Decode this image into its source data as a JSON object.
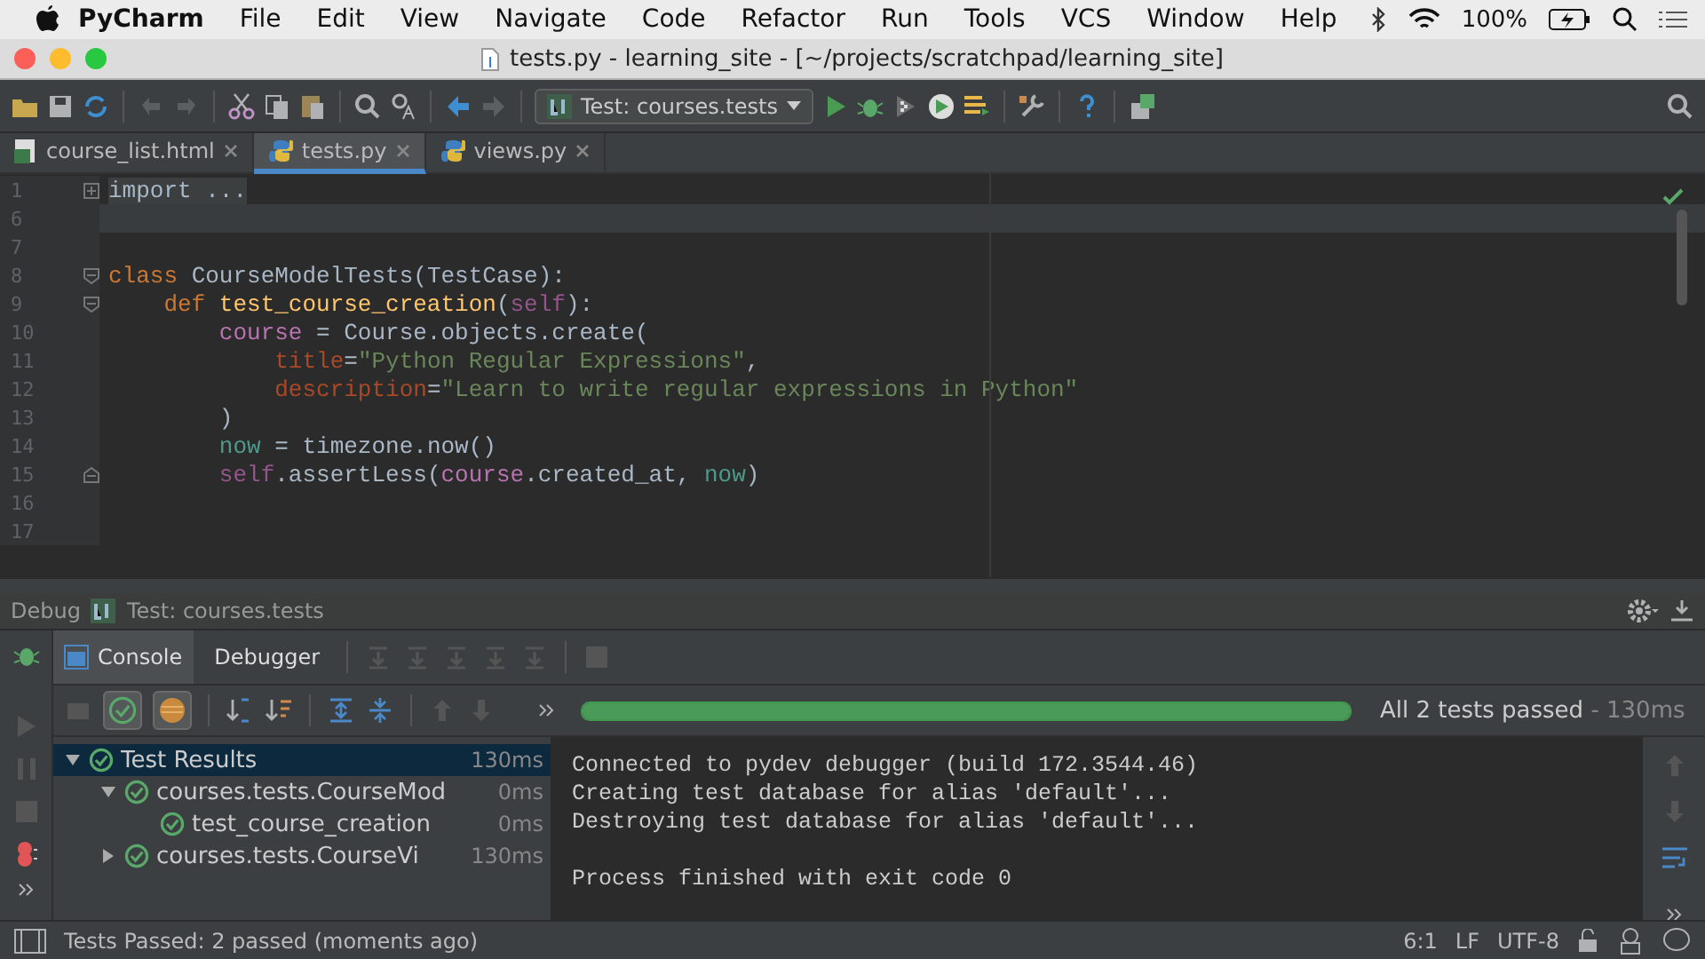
{
  "menubar": {
    "app": "PyCharm",
    "menus": [
      "File",
      "Edit",
      "View",
      "Navigate",
      "Code",
      "Refactor",
      "Run",
      "Tools",
      "VCS",
      "Window",
      "Help"
    ],
    "battery": "100%"
  },
  "window": {
    "title": "tests.py - learning_site - [~/projects/scratchpad/learning_site]"
  },
  "toolbar": {
    "run_config": "Test: courses.tests"
  },
  "tabs": [
    {
      "label": "course_list.html",
      "kind": "html",
      "selected": false
    },
    {
      "label": "tests.py",
      "kind": "python",
      "selected": true
    },
    {
      "label": "views.py",
      "kind": "python",
      "selected": false
    }
  ],
  "editor": {
    "lines": [
      {
        "number": "1",
        "current": false,
        "kind": "folded",
        "tokens": [
          {
            "kind": "folded",
            "text": "import ..."
          }
        ]
      },
      {
        "number": "6",
        "current": true,
        "kind": "plain"
      },
      {
        "number": "7",
        "current": false,
        "kind": "plain"
      },
      {
        "number": "8",
        "current": false,
        "kind": "fold_start",
        "tokens": [
          {
            "kind": "keyword",
            "text": "class"
          },
          {
            "kind": "plain",
            "text": " CourseModelTests(TestCase):"
          }
        ]
      },
      {
        "number": "9",
        "current": false,
        "kind": "fold_start",
        "tokens": [
          {
            "kind": "keyword",
            "text": "    def"
          },
          {
            "kind": "function",
            "text": " test_course_creation"
          },
          {
            "kind": "plain",
            "text": "("
          },
          {
            "kind": "self",
            "text": "self"
          },
          {
            "kind": "plain",
            "text": "):"
          }
        ]
      },
      {
        "number": "10",
        "current": false,
        "kind": "plain",
        "tokens": [
          {
            "kind": "local",
            "text": "        course"
          },
          {
            "kind": "plain",
            "text": " = Course.objects.create("
          }
        ]
      },
      {
        "number": "11",
        "current": false,
        "kind": "plain",
        "tokens": [
          {
            "kind": "kwarg",
            "text": "            title"
          },
          {
            "kind": "plain",
            "text": "="
          },
          {
            "kind": "string",
            "text": "\"Python Regular Expressions\""
          },
          {
            "kind": "plain",
            "text": ","
          }
        ]
      },
      {
        "number": "12",
        "current": false,
        "kind": "plain",
        "tokens": [
          {
            "kind": "kwarg",
            "text": "            description"
          },
          {
            "kind": "plain",
            "text": "="
          },
          {
            "kind": "string",
            "text": "\"Learn to write regular expressions in Python\""
          }
        ]
      },
      {
        "number": "13",
        "current": false,
        "kind": "plain",
        "tokens": [
          {
            "kind": "plain",
            "text": "        )"
          }
        ]
      },
      {
        "number": "14",
        "current": false,
        "kind": "plain",
        "tokens": [
          {
            "kind": "variable",
            "text": "        now"
          },
          {
            "kind": "plain",
            "text": " = timezone.now()"
          }
        ]
      },
      {
        "number": "15",
        "current": false,
        "kind": "fold_end",
        "tokens": [
          {
            "kind": "self",
            "text": "        self"
          },
          {
            "kind": "plain",
            "text": ".assertLess("
          },
          {
            "kind": "local",
            "text": "course"
          },
          {
            "kind": "plain",
            "text": ".created_at, "
          },
          {
            "kind": "variable",
            "text": "now"
          },
          {
            "kind": "plain",
            "text": ")"
          }
        ]
      },
      {
        "number": "16",
        "current": false,
        "kind": "plain"
      },
      {
        "number": "17",
        "current": false,
        "kind": "plain"
      }
    ]
  },
  "debug": {
    "title": "Debug",
    "config": "Test: courses.tests",
    "tabs": [
      {
        "label": "Console",
        "selected": true
      },
      {
        "label": "Debugger",
        "selected": false
      }
    ],
    "progress": {
      "level": 1
    },
    "summary": "All 2 tests passed",
    "duration": "- 130ms",
    "tree": [
      {
        "label": "Test Results",
        "time": "130ms",
        "selected": true,
        "expanded": true,
        "children": [
          {
            "label": "courses.tests.CourseMod",
            "time": "0ms",
            "selected": false,
            "expanded": true,
            "children": [
              {
                "label": "test_course_creation",
                "time": "0ms",
                "selected": false
              }
            ]
          },
          {
            "label": "courses.tests.CourseVi",
            "time": "130ms",
            "selected": false,
            "expanded": false
          }
        ]
      }
    ],
    "console": [
      {
        "kind": "info",
        "text": "Connected to pydev debugger (build 172.3544.46)"
      },
      {
        "kind": "info",
        "text": "Creating test database for alias 'default'..."
      },
      {
        "kind": "info",
        "text": "Destroying test database for alias 'default'..."
      },
      {
        "kind": "exit",
        "text": "Process finished with exit code 0"
      }
    ]
  },
  "status_bar": {
    "message": "Tests Passed: 2 passed (moments ago)",
    "position": "6:1",
    "line_separator": "LF",
    "encoding": "UTF-8"
  }
}
